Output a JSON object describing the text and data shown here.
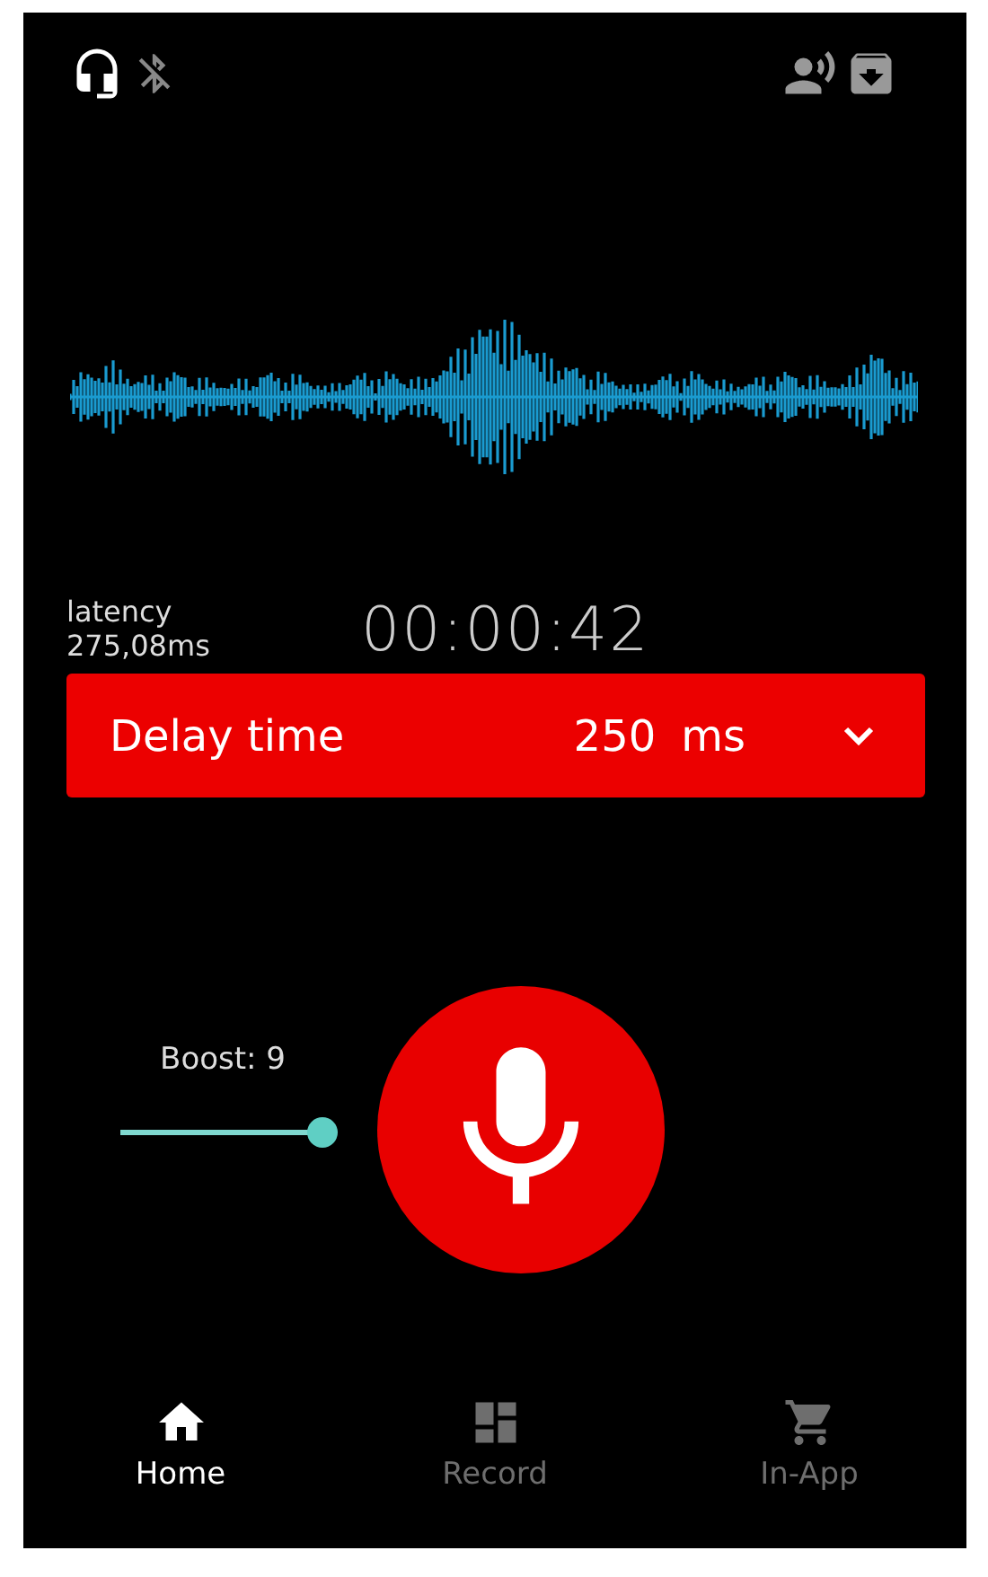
{
  "latency": {
    "label": "latency",
    "value": "275,08ms"
  },
  "timer": "00:00:42",
  "delay": {
    "label": "Delay time",
    "value": "250",
    "unit": "ms"
  },
  "boost": {
    "label": "Boost: 9",
    "level": 1
  },
  "nav": [
    {
      "label": "Home",
      "kind": "home",
      "selected": true
    },
    {
      "label": "Record",
      "kind": "dashboard",
      "selected": false
    },
    {
      "label": "In-App",
      "kind": "cart",
      "selected": false
    }
  ]
}
